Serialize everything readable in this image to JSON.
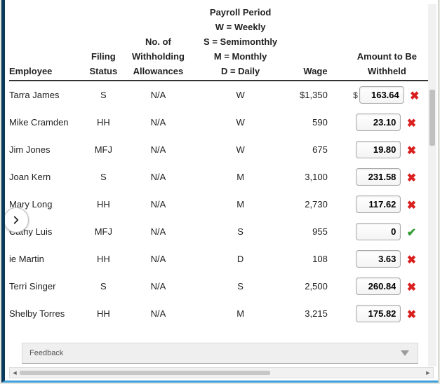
{
  "headers": {
    "employee": "Employee",
    "filing_status": "Filing Status",
    "withholding_line1": "No. of",
    "withholding_line2": "Withholding",
    "withholding_line3": "Allowances",
    "period_title": "Payroll Period",
    "period_w": "W = Weekly",
    "period_s": "S = Semimonthly",
    "period_m": "M = Monthly",
    "period_d": "D = Daily",
    "wage": "Wage",
    "amount_line1": "Amount to Be",
    "amount_line2": "Withheld"
  },
  "dollar_prefix": "$",
  "rows": [
    {
      "employee": "Tarra James",
      "filing": "S",
      "allow": "N/A",
      "period": "W",
      "wage": "$1,350",
      "amount": "163.64",
      "correct": false
    },
    {
      "employee": "Mike Cramden",
      "filing": "HH",
      "allow": "N/A",
      "period": "W",
      "wage": "590",
      "amount": "23.10",
      "correct": false
    },
    {
      "employee": "Jim Jones",
      "filing": "MFJ",
      "allow": "N/A",
      "period": "W",
      "wage": "675",
      "amount": "19.80",
      "correct": false
    },
    {
      "employee": "Joan Kern",
      "filing": "S",
      "allow": "N/A",
      "period": "M",
      "wage": "3,100",
      "amount": "231.58",
      "correct": false
    },
    {
      "employee": "Mary Long",
      "filing": "HH",
      "allow": "N/A",
      "period": "M",
      "wage": "2,730",
      "amount": "117.62",
      "correct": false
    },
    {
      "employee": "Cathy Luis",
      "filing": "MFJ",
      "allow": "N/A",
      "period": "S",
      "wage": "955",
      "amount": "0",
      "correct": true
    },
    {
      "employee": "ie Martin",
      "filing": "HH",
      "allow": "N/A",
      "period": "D",
      "wage": "108",
      "amount": "3.63",
      "correct": false
    },
    {
      "employee": "Terri Singer",
      "filing": "S",
      "allow": "N/A",
      "period": "S",
      "wage": "2,500",
      "amount": "260.84",
      "correct": false
    },
    {
      "employee": "Shelby Torres",
      "filing": "HH",
      "allow": "N/A",
      "period": "M",
      "wage": "3,215",
      "amount": "175.82",
      "correct": false
    }
  ],
  "feedback": {
    "label": "Feedback"
  },
  "marks": {
    "x": "✖",
    "v": "✔"
  }
}
